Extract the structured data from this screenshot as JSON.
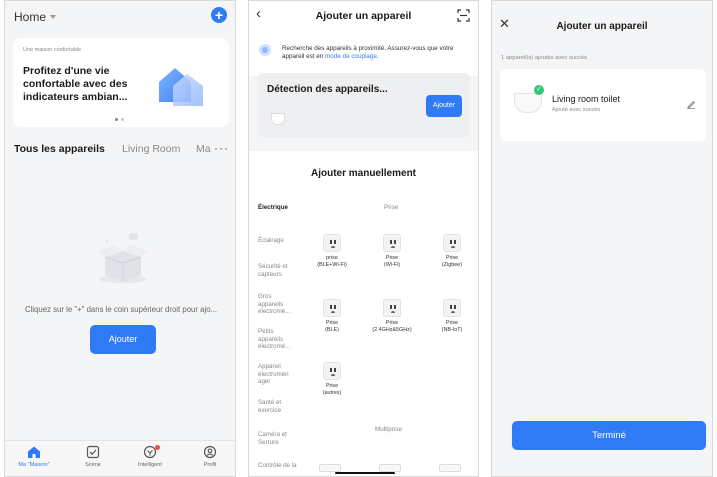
{
  "screen1": {
    "home_title": "Home",
    "banner": {
      "small_label": "Une maison confortable",
      "title": "Profitez d'une vie confortable avec des indicateurs ambian..."
    },
    "tabs": [
      "Tous les appareils",
      "Living Room",
      "Ma"
    ],
    "empty_text": "Cliquez sur le \"+\" dans le coin supérieur droit pour ajo...",
    "add_button": "Ajouter",
    "nav": [
      {
        "label": "Ma \"Maison\"",
        "icon": "home-icon",
        "active": true
      },
      {
        "label": "Scène",
        "icon": "scene-icon",
        "active": false
      },
      {
        "label": "Intelligent",
        "icon": "smart-icon",
        "active": false
      },
      {
        "label": "Profil",
        "icon": "profile-icon",
        "active": false
      }
    ],
    "accent_color": "#2f7bf5"
  },
  "screen2": {
    "title": "Ajouter un appareil",
    "search_text": "Recherche des appareils à proximité. Assurez-vous que votre appareil est en ",
    "search_link": "mode de couplage",
    "search_end": ".",
    "detect_title": "Détection des appareils...",
    "detect_button": "Ajouter",
    "manual_title": "Ajouter manuellement",
    "categories": [
      "Électrique",
      "Éclairage",
      "Sécurité et capteurs",
      "Gros appareils électromé...",
      "Petits appareils électromé...",
      "Appareil électromén ager",
      "Santé et exercice",
      "Caméra et Serrure",
      "Contrôle de la"
    ],
    "section_prise": "Prise",
    "section_multiprise": "Multiprise",
    "devices": [
      [
        "prise",
        "(BLE+Wi-Fi)"
      ],
      [
        "Prise",
        "(Wi-Fi)"
      ],
      [
        "Prise",
        "(Zigbee)"
      ],
      [
        "Prise",
        "(BLE)"
      ],
      [
        "Prise",
        "(2.4GHz&5GHz)"
      ],
      [
        "Prise",
        "(NB-IoT)"
      ],
      [
        "Prise",
        "(autres)"
      ]
    ]
  },
  "screen3": {
    "title": "Ajouter un appareil",
    "added_note": "1 appareil(s) ajoutés avec succès",
    "device_name": "Living room toilet",
    "device_status": "Ajouté avec succès",
    "done_button": "Terminé",
    "success_color": "#35c47a"
  }
}
